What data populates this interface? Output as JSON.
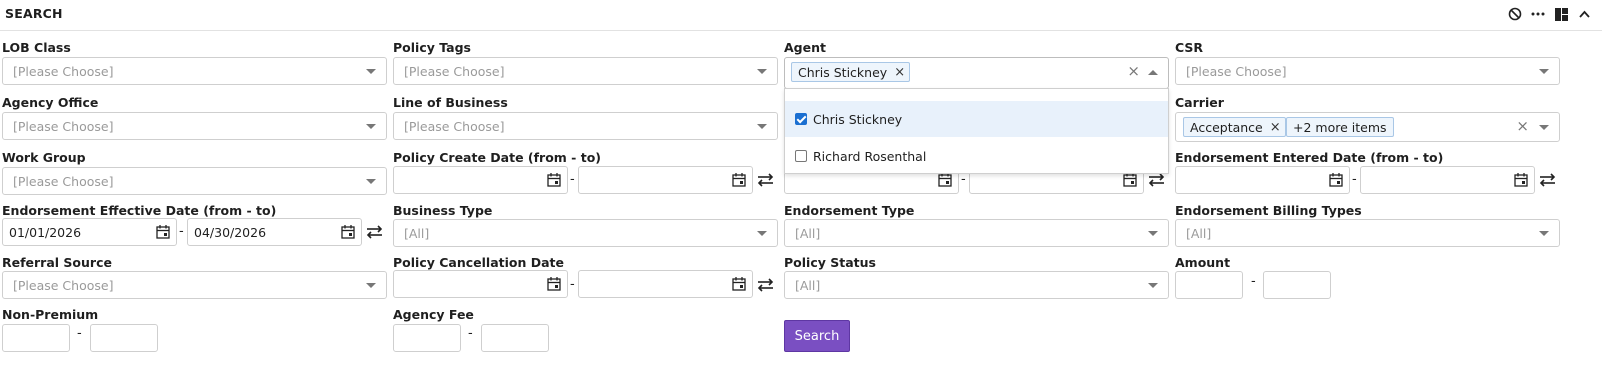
{
  "header": {
    "title": "SEARCH"
  },
  "placeholders": {
    "choose": "[Please Choose]",
    "all": "[All]"
  },
  "fields": {
    "lob_class": "LOB Class",
    "policy_tags": "Policy Tags",
    "agent": "Agent",
    "csr": "CSR",
    "agency_office": "Agency Office",
    "line_of_business": "Line of Business",
    "carrier": "Carrier",
    "work_group": "Work Group",
    "policy_create_date": "Policy Create Date (from - to)",
    "endorsement_entered_date": "Endorsement Entered Date (from - to)",
    "endorsement_effective_date": "Endorsement Effective Date (from - to)",
    "business_type": "Business Type",
    "endorsement_type": "Endorsement Type",
    "endorsement_billing_types": "Endorsement Billing Types",
    "referral_source": "Referral Source",
    "policy_cancellation_date": "Policy Cancellation Date",
    "policy_status": "Policy Status",
    "amount": "Amount",
    "non_premium": "Non-Premium",
    "agency_fee": "Agency Fee"
  },
  "agent": {
    "selected_chip": "Chris Stickney",
    "options": [
      {
        "label": "Chris Stickney",
        "checked": true
      },
      {
        "label": "Richard Rosenthal",
        "checked": false
      }
    ]
  },
  "carrier": {
    "chip": "Acceptance",
    "more": "+2 more items"
  },
  "endorsement_effective": {
    "from": "01/01/2026",
    "to": "04/30/2026"
  },
  "range_separator": "-",
  "search_button": "Search",
  "icons": [
    "block-icon",
    "more-icon",
    "layout-icon",
    "chevron-up-icon",
    "chevron-down-icon",
    "calendar-icon",
    "swap-icon",
    "close-icon",
    "checkbox-icon"
  ],
  "colors": {
    "primary_button": "#7a4fc2",
    "chip_bg": "#eef5fc",
    "chip_border": "#a9c7e6",
    "selected_option_bg": "#e8f1fb",
    "checkbox_checked": "#1a6fd1"
  }
}
